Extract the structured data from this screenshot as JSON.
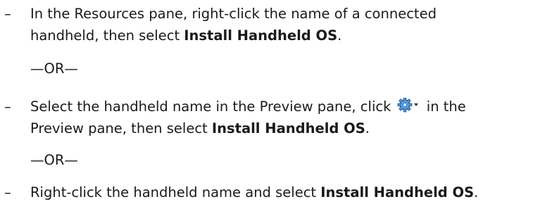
{
  "steps": [
    {
      "dash": "–",
      "line1": "In the Resources pane, right-click the name of a connected",
      "line2_pre": "handheld, then select ",
      "line2_bold": "Install Handheld OS",
      "line2_post": "."
    },
    {
      "dash": "–",
      "line1_pre": "Select the handheld name in the Preview pane, click ",
      "line1_post": " in the",
      "icon": "gear-dropdown-icon",
      "line2_pre": "Preview pane, then select ",
      "line2_bold": "Install Handheld OS",
      "line2_post": "."
    },
    {
      "dash": "–",
      "line1_pre": "Right-click the handheld name and select ",
      "line1_bold": "Install Handheld OS",
      "line1_post": "."
    }
  ],
  "separators": [
    "—OR—",
    "—OR—"
  ],
  "colors": {
    "text": "#1a1a1a",
    "gear_blue": "#4a8fd6",
    "gear_dark": "#2c5f96"
  }
}
